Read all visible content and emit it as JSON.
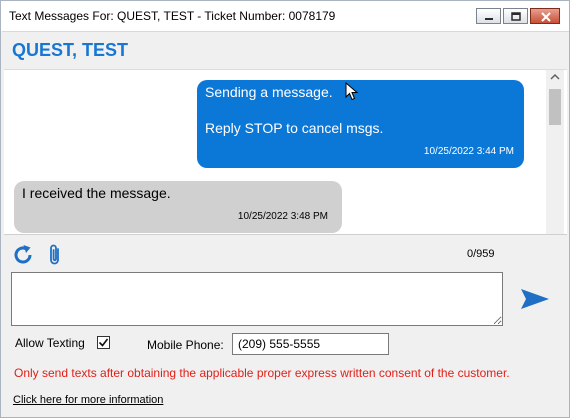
{
  "window": {
    "title": "Text Messages For: QUEST, TEST - Ticket Number: 0078179",
    "icons": [
      "minimize-icon",
      "maximize-icon",
      "close-icon"
    ]
  },
  "header": {
    "contact_name": "QUEST, TEST"
  },
  "messages": [
    {
      "direction": "outgoing",
      "lines": [
        "Sending a message.",
        "Reply STOP to cancel msgs."
      ],
      "timestamp": "10/25/2022 3:44 PM"
    },
    {
      "direction": "incoming",
      "lines": [
        "I received the message."
      ],
      "timestamp": "10/25/2022 3:48 PM"
    }
  ],
  "toolbar": {
    "icons": [
      "refresh-icon",
      "attachment-icon"
    ],
    "char_counter": "0/959"
  },
  "compose": {
    "value": "",
    "send_icon": "send-icon"
  },
  "options": {
    "allow_texting_label": "Allow Texting",
    "allow_texting_checked": true,
    "mobile_phone_label": "Mobile Phone:",
    "mobile_phone_value": "(209) 555-5555"
  },
  "notice": {
    "consent_text": "Only send texts after obtaining the applicable proper express written consent of the customer.",
    "more_info_link": "Click here for more information"
  },
  "colors": {
    "accent": "#1877d3",
    "outgoing_bubble": "#0b78d8",
    "incoming_bubble": "#d0d0d0",
    "warning_text": "#e0201a"
  }
}
